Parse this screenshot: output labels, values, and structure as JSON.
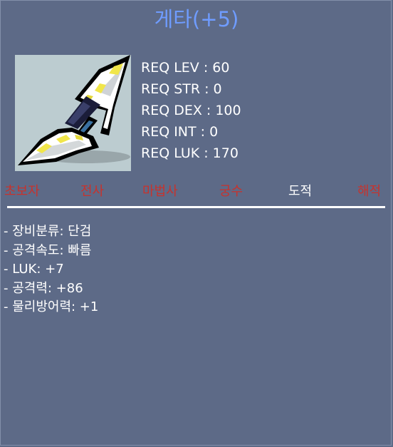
{
  "item": {
    "title": "게타(+5)",
    "icon": "dagger-icon"
  },
  "requirements": [
    "REQ LEV : 60",
    "REQ STR : 0",
    "REQ DEX : 100",
    "REQ INT : 0",
    "REQ LUK : 170"
  ],
  "jobs": [
    {
      "label": "초보자",
      "allowed": false
    },
    {
      "label": "전사",
      "allowed": false
    },
    {
      "label": "마법사",
      "allowed": false
    },
    {
      "label": "궁수",
      "allowed": false
    },
    {
      "label": "도적",
      "allowed": true
    },
    {
      "label": "해적",
      "allowed": false
    }
  ],
  "stats": [
    "- 장비분류: 단검",
    "- 공격속도: 빠름",
    "- LUK: +7",
    "- 공격력: +86",
    "- 물리방어력: +1"
  ],
  "colors": {
    "background": "#5d6a87",
    "title": "#6f9cff",
    "job_disallowed": "#c8322c",
    "job_allowed": "#ffffff",
    "icon_background": "#bcccd0"
  }
}
